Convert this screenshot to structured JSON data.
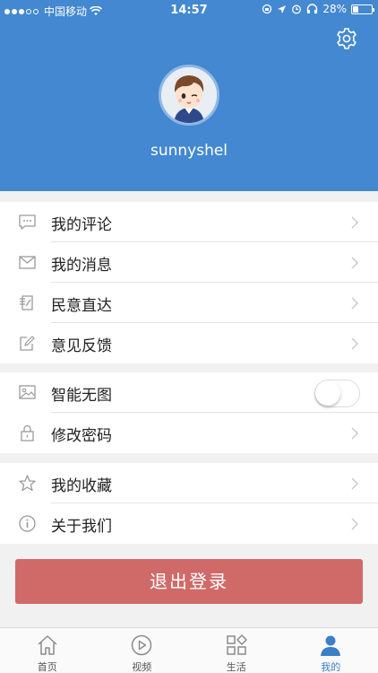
{
  "status_bar": {
    "carrier": "中国移动",
    "time": "14:57",
    "battery": "28%",
    "battery_level": 0.28
  },
  "profile": {
    "username": "sunnyshel"
  },
  "menu_groups": [
    {
      "items": [
        {
          "label": "我的评论",
          "icon": "comment-icon"
        },
        {
          "label": "我的消息",
          "icon": "mail-icon"
        },
        {
          "label": "民意直达",
          "icon": "petition-icon"
        },
        {
          "label": "意见反馈",
          "icon": "edit-icon"
        }
      ]
    },
    {
      "items": [
        {
          "label": "智能无图",
          "icon": "image-icon",
          "toggle": false
        },
        {
          "label": "修改密码",
          "icon": "lock-icon"
        }
      ]
    },
    {
      "items": [
        {
          "label": "我的收藏",
          "icon": "star-icon"
        },
        {
          "label": "关于我们",
          "icon": "info-icon"
        }
      ]
    }
  ],
  "logout_label": "退出登录",
  "tabs": [
    {
      "label": "首页",
      "icon": "home-icon"
    },
    {
      "label": "视频",
      "icon": "play-icon"
    },
    {
      "label": "生活",
      "icon": "grid-icon"
    },
    {
      "label": "我的",
      "icon": "person-icon",
      "active": true
    }
  ],
  "colors": {
    "header": "#4388d0",
    "logout": "#d06a69",
    "active_tab": "#3c7fc8"
  }
}
